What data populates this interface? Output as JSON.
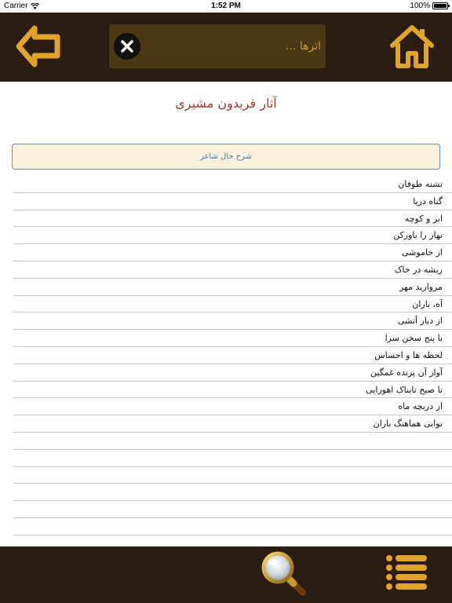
{
  "status_bar": {
    "carrier": "Carrier",
    "time": "1:52 PM",
    "battery": "100%"
  },
  "header": {
    "search_placeholder": "اثرها ...",
    "icons": {
      "back": "arrow-left-icon",
      "clear": "close-circle-icon",
      "home": "home-icon"
    }
  },
  "page": {
    "title": "آثار فریدون مشیری",
    "bio_button_label": "شرح حال شاعر"
  },
  "works": [
    "تشنه طوفان",
    "گناه دریا",
    "ابر و کوچه",
    "بهار را باورکن",
    "از خاموشی",
    "ریشه در خاک",
    "مروارید مهر",
    "آه، باران",
    "از دیار آتشی",
    "با پنج سخن سرا",
    "لحظه ها و احساس",
    "آواز آن پرنده غمگین",
    "تا صبح تابناک اهورایی",
    "از دریچه ماه",
    "نوایی هماهنگ باران"
  ],
  "toolbar": {
    "icons": {
      "search": "magnifier-icon",
      "menu": "list-menu-icon"
    }
  },
  "colors": {
    "bar_background": "#2a1c12",
    "accent_gold": "#e0a42a",
    "title_red": "#a33a2a",
    "link_blue": "#3f7aa8"
  }
}
